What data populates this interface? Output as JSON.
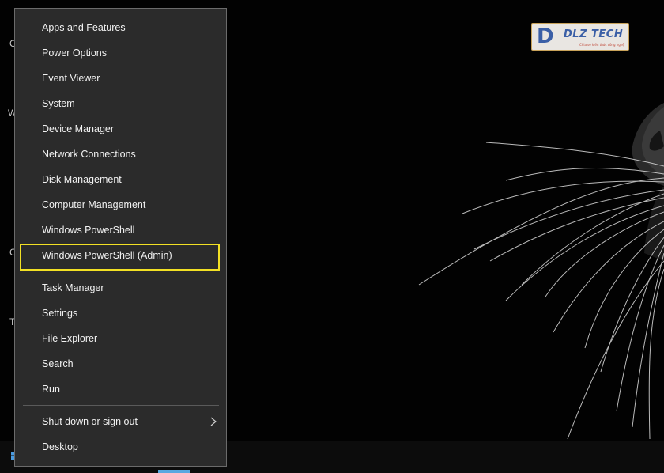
{
  "menu": {
    "items": [
      {
        "id": "apps",
        "label": "Apps and Features"
      },
      {
        "id": "power",
        "label": "Power Options"
      },
      {
        "id": "event",
        "label": "Event Viewer"
      },
      {
        "id": "system",
        "label": "System"
      },
      {
        "id": "device",
        "label": "Device Manager"
      },
      {
        "id": "network",
        "label": "Network Connections"
      },
      {
        "id": "disk",
        "label": "Disk Management"
      },
      {
        "id": "computer",
        "label": "Computer Management"
      },
      {
        "id": "powershell",
        "label": "Windows PowerShell"
      },
      {
        "id": "powershell-admin",
        "label": "Windows PowerShell (Admin)",
        "highlighted": true
      },
      {
        "id": "task",
        "label": "Task Manager"
      },
      {
        "id": "settings",
        "label": "Settings"
      },
      {
        "id": "explorer",
        "label": "File Explorer"
      },
      {
        "id": "search",
        "label": "Search"
      },
      {
        "id": "run",
        "label": "Run"
      },
      {
        "id": "shutdown",
        "label": "Shut down or sign out",
        "has_submenu": true
      },
      {
        "id": "desktop",
        "label": "Desktop"
      }
    ]
  },
  "left_edge_letters": [
    "C",
    "W",
    "C",
    "T"
  ],
  "watermark": {
    "brand_letter": "D",
    "brand_name": "DLZ TECH",
    "tagline": "Chia sẻ kiến thức công nghệ"
  },
  "colors": {
    "menu_bg": "#2b2b2b",
    "menu_border": "#6b6b6b",
    "highlight": "#f2e024",
    "text": "#f2f2f2",
    "desktop_bg": "#000000"
  },
  "icons": {
    "submenu": "chevron-right-icon",
    "start": "windows-start-icon"
  }
}
